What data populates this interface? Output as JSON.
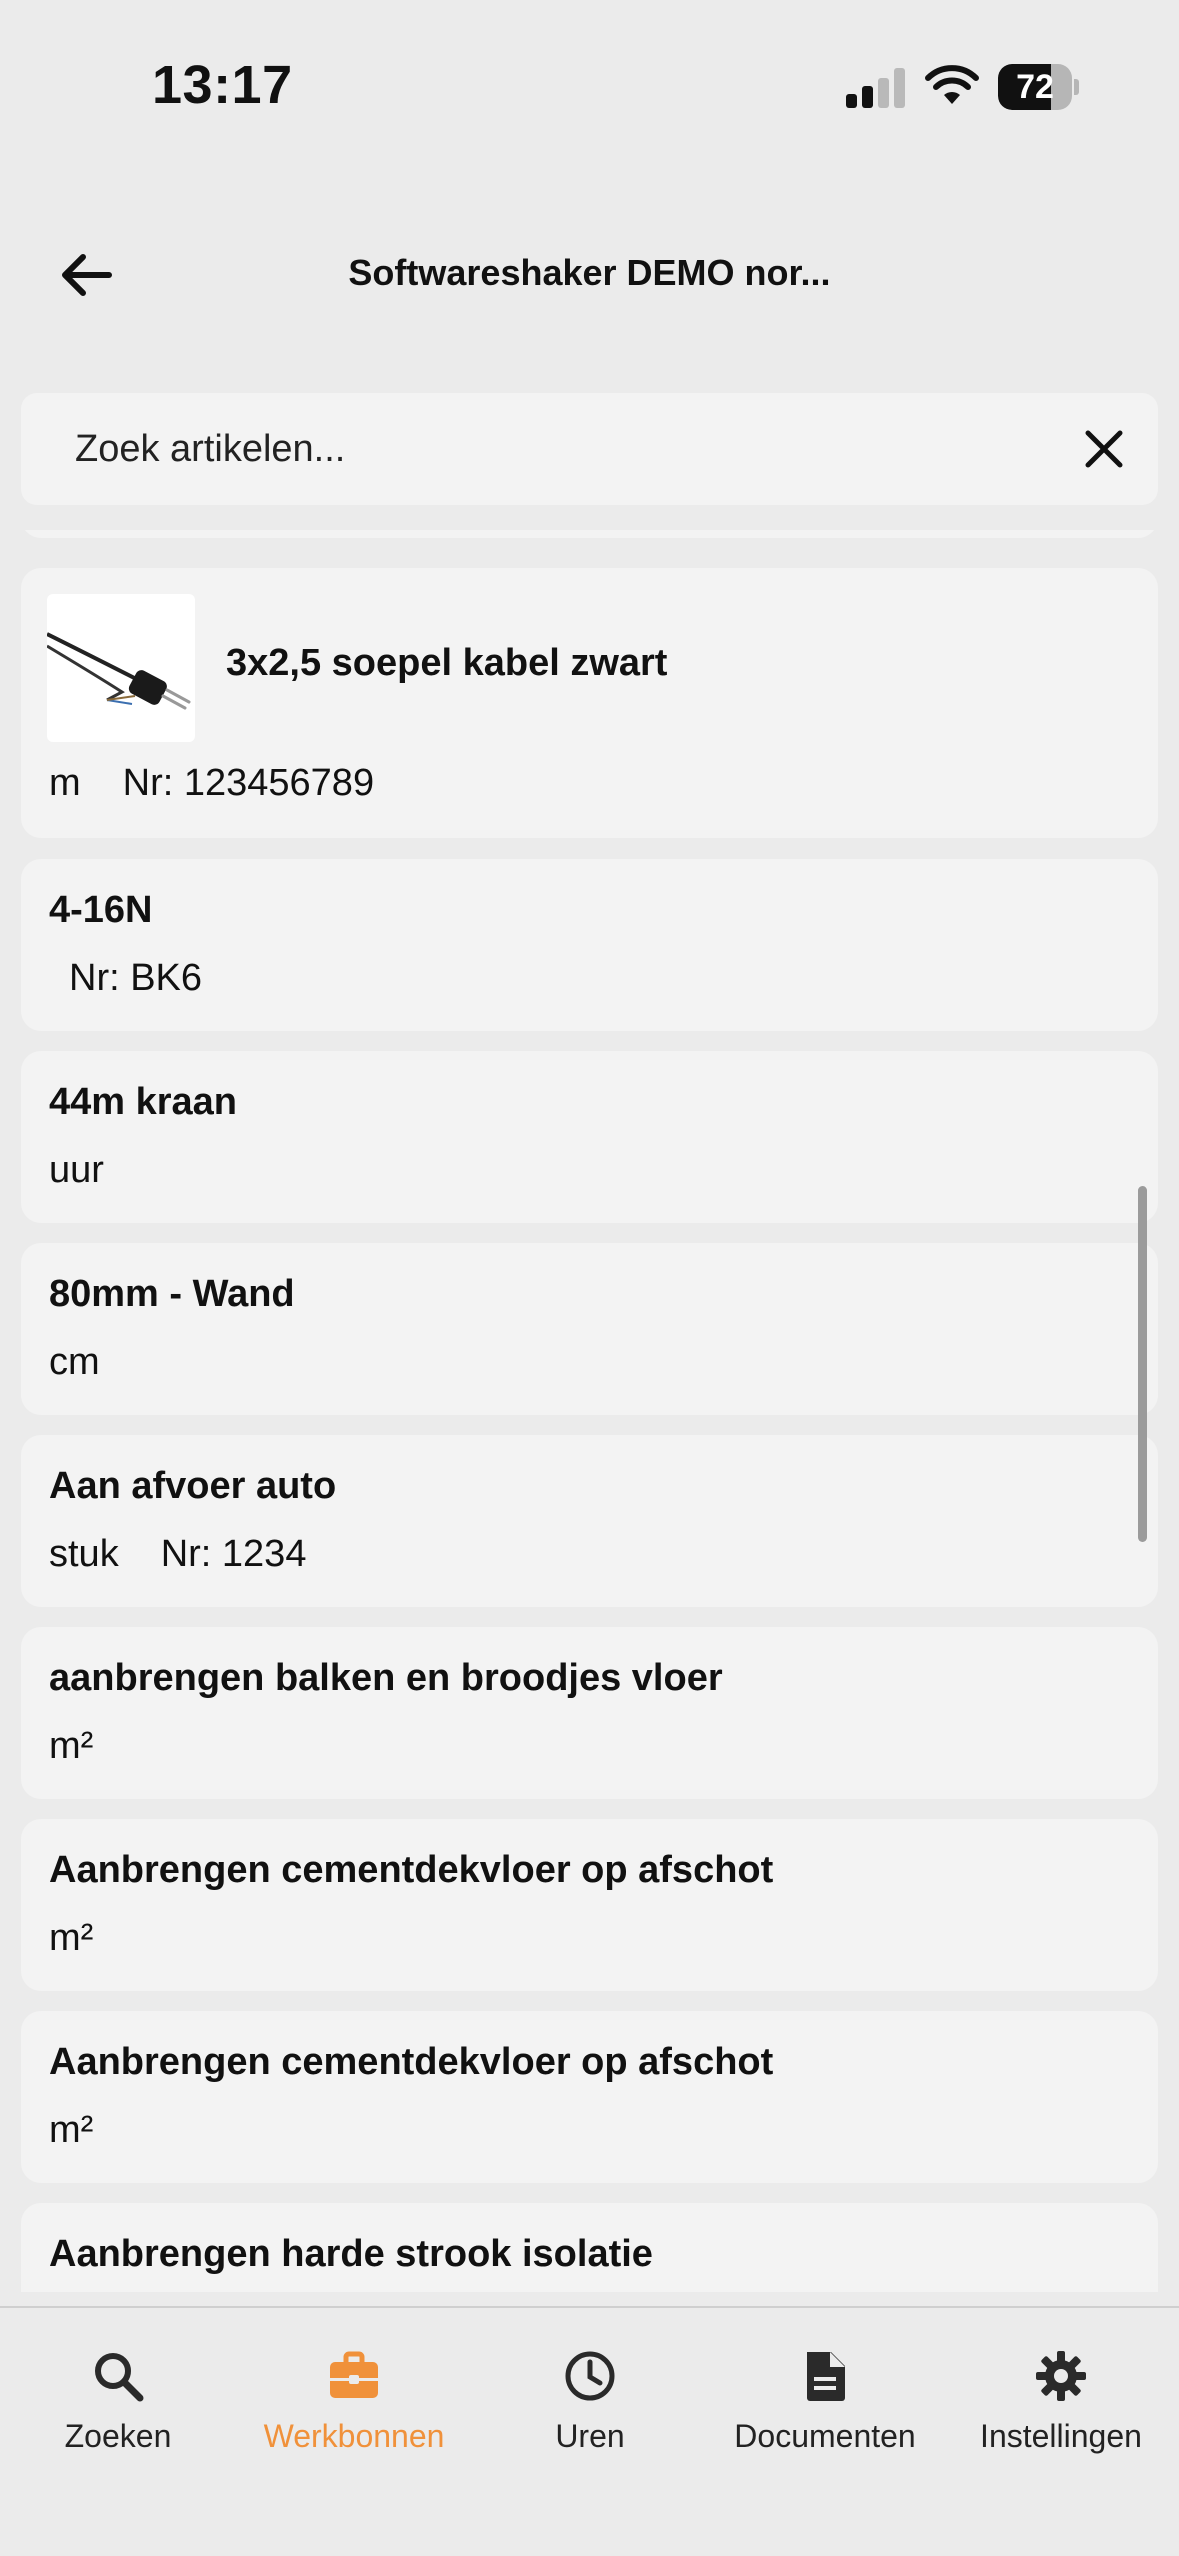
{
  "status_bar": {
    "time": "13:17",
    "battery": "72",
    "battery_level": 0.72
  },
  "header": {
    "title": "Softwareshaker DEMO nor..."
  },
  "search": {
    "placeholder": "Zoek artikelen..."
  },
  "articles": [
    {
      "title": "3x2,5 soepel kabel zwart",
      "unit": "m",
      "number": "Nr: 123456789",
      "image": "power-cable-image"
    },
    {
      "title": "4-16N",
      "unit": "",
      "number": "Nr: BK6"
    },
    {
      "title": "44m kraan",
      "unit": "uur",
      "number": ""
    },
    {
      "title": "80mm - Wand",
      "unit": "cm",
      "number": ""
    },
    {
      "title": "Aan afvoer auto",
      "unit": "stuk",
      "number": "Nr: 1234"
    },
    {
      "title": "aanbrengen balken en broodjes vloer",
      "unit": "m²",
      "number": ""
    },
    {
      "title": "Aanbrengen cementdekvloer op afschot",
      "unit": "m²",
      "number": ""
    },
    {
      "title": "Aanbrengen cementdekvloer op afschot",
      "unit": "m²",
      "number": ""
    },
    {
      "title": "Aanbrengen harde strook isolatie",
      "unit": "",
      "number": ""
    }
  ],
  "tabs": [
    {
      "label": "Zoeken",
      "icon": "search-icon",
      "active": false
    },
    {
      "label": "Werkbonnen",
      "icon": "briefcase-icon",
      "active": true
    },
    {
      "label": "Uren",
      "icon": "clock-icon",
      "active": false
    },
    {
      "label": "Documenten",
      "icon": "document-icon",
      "active": false
    },
    {
      "label": "Instellingen",
      "icon": "gear-icon",
      "active": false
    }
  ],
  "colors": {
    "accent": "#f0913a",
    "background": "#ebebeb",
    "card": "#f3f3f3"
  }
}
